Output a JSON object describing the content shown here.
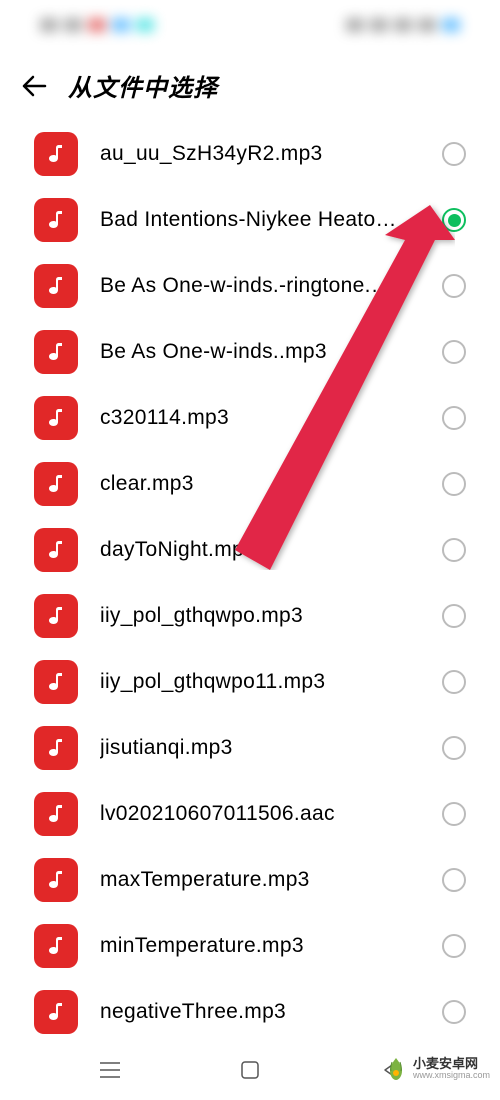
{
  "header": {
    "title": "从文件中选择"
  },
  "files": [
    {
      "name": "au_uu_SzH34yR2.mp3",
      "selected": false
    },
    {
      "name": "Bad Intentions-Niykee Heato…",
      "selected": true
    },
    {
      "name": "Be As One-w-inds.-ringtone.…",
      "selected": false
    },
    {
      "name": "Be As One-w-inds..mp3",
      "selected": false
    },
    {
      "name": "c320114.mp3",
      "selected": false
    },
    {
      "name": "clear.mp3",
      "selected": false
    },
    {
      "name": "dayToNight.mp3",
      "selected": false
    },
    {
      "name": "iiy_pol_gthqwpo.mp3",
      "selected": false
    },
    {
      "name": "iiy_pol_gthqwpo11.mp3",
      "selected": false
    },
    {
      "name": "jisutianqi.mp3",
      "selected": false
    },
    {
      "name": "lv020210607011506.aac",
      "selected": false
    },
    {
      "name": "maxTemperature.mp3",
      "selected": false
    },
    {
      "name": "minTemperature.mp3",
      "selected": false
    },
    {
      "name": "negativeThree.mp3",
      "selected": false
    }
  ],
  "watermark": {
    "brand": "小麦安卓网",
    "url": "www.xmsigma.com"
  },
  "annotation": {
    "arrow_color": "#e12846"
  }
}
